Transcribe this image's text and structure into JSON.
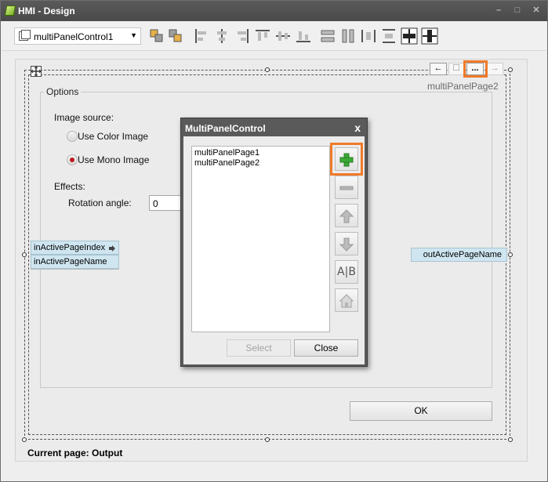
{
  "window": {
    "title": "HMI - Design",
    "minimize": "–",
    "maximize": "□",
    "close": "✕"
  },
  "toolbar": {
    "component_select": {
      "value": "multiPanelControl1"
    },
    "align_buttons": [
      "bring-front-icon",
      "send-back-icon",
      "align-left-icon",
      "align-center-icon",
      "align-right-icon",
      "align-top-icon",
      "align-middle-icon",
      "align-bottom-icon",
      "same-width-icon",
      "same-height-icon",
      "space-horizontal-icon",
      "space-vertical-icon",
      "center-horizontal-icon",
      "center-vertical-icon"
    ]
  },
  "design": {
    "page_nav": {
      "prev": "←",
      "square": "☐",
      "more": "...",
      "next": "→"
    },
    "page_title": "multiPanelPage2",
    "options_group": "Options",
    "image_source_label": "Image source:",
    "use_color_image": "Use Color Image",
    "use_mono_image": "Use Mono Image",
    "effects_label": "Effects:",
    "rotation_angle_label": "Rotation angle:",
    "rotation_angle_value": "0",
    "ports_in": [
      "inActivePageIndex",
      "inActivePageName"
    ],
    "port_out": "outActivePageName",
    "ok_button": "OK",
    "status": "Current page: Output",
    "selected_option": "use_mono_image"
  },
  "dialog": {
    "title": "MultiPanelControl",
    "close": "x",
    "pages": [
      "multiPanelPage1",
      "multiPanelPage2"
    ],
    "select_button": "Select",
    "close_button": "Close",
    "side_buttons": [
      "add-page-icon",
      "remove-page-icon",
      "move-up-icon",
      "move-down-icon",
      "rename-icon",
      "home-icon"
    ],
    "rename_glyph": "A|B"
  },
  "colors": {
    "highlight": "#f07a2a",
    "port_bg": "#cfe6f1",
    "titlebar": "#4e4e4e"
  }
}
